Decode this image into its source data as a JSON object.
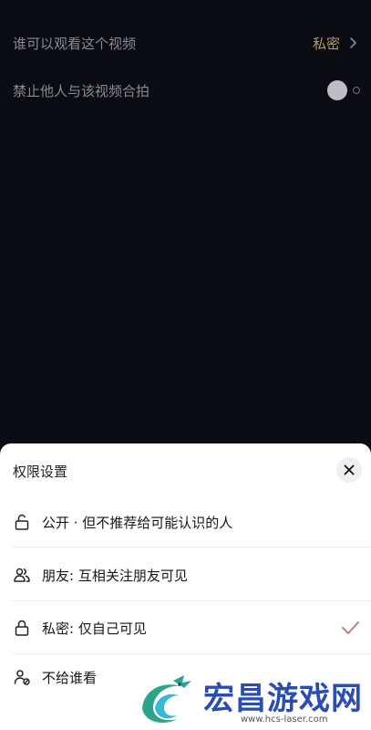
{
  "settings": {
    "rows": [
      {
        "label": "谁可以观看这个视频",
        "value": "私密"
      },
      {
        "label": "禁止他人与该视频合拍",
        "toggle_on": false
      }
    ]
  },
  "sheet": {
    "title": "权限设置",
    "options": [
      {
        "icon": "unlock-icon",
        "label": "公开 · 但不推荐给可能认识的人",
        "selected": false
      },
      {
        "icon": "friends-icon",
        "label": "朋友: 互相关注朋友可见",
        "selected": false
      },
      {
        "icon": "lock-icon",
        "label": "私密: 仅自己可见",
        "selected": true
      },
      {
        "icon": "person-block-icon",
        "label": "不给谁看",
        "selected": false
      }
    ]
  },
  "watermark": {
    "brand": "宏昌游戏网",
    "url": "www.hcs-laser.com"
  },
  "colors": {
    "background": "#0b0b12",
    "value_gold": "#b49a6c",
    "check_red": "#c47b77",
    "watermark_blue": "#2c4db0"
  }
}
